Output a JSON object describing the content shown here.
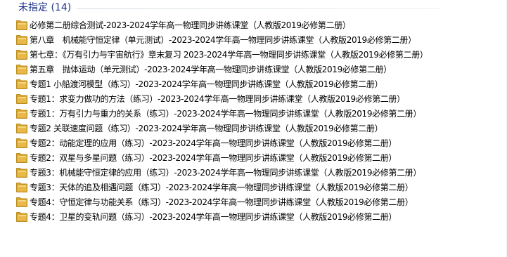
{
  "group": {
    "label": "未指定",
    "count_text": "(14)"
  },
  "icons": {
    "item_icon": "folder-icon",
    "folder_color": "#e8b84a"
  },
  "items": [
    {
      "name": "必修第二册综合测试-2023-2024学年高一物理同步讲练课堂（人教版2019必修第二册）"
    },
    {
      "name": "第八章　机械能守恒定律（单元测试）-2023-2024学年高一物理同步讲练课堂（人教版2019必修第二册）"
    },
    {
      "name": "第七章：《万有引力与宇宙航行》章末复习 2023-2024学年高一物理同步讲练课堂（人教版2019必修第二册）"
    },
    {
      "name": "第五章　抛体运动（单元测试）-2023-2024学年高一物理同步讲练课堂（人教版2019必修第二册）"
    },
    {
      "name": "专题1  小船渡河模型（练习）-2023-2024学年高一物理同步讲练课堂（人教版2019必修第二册）"
    },
    {
      "name": "专题1：求变力做功的方法（练习）-2023-2024学年高一物理同步讲练课堂（人教版2019必修第二册）"
    },
    {
      "name": "专题1：万有引力与重力的关系（练习）-2023-2024学年高一物理同步讲练课堂（人教版2019必修第二册）"
    },
    {
      "name": "专题2  关联速度问题（练习）-2023-2024学年高一物理同步讲练课堂（人教版2019必修第二册）"
    },
    {
      "name": "专题2：动能定理的应用（练习）-2023-2024学年高一物理同步讲练课堂（人教版2019必修第二册）"
    },
    {
      "name": "专题2：双星与多星问题（练习）-2023-2024学年高一物理同步讲练课堂（人教版2019必修第二册）"
    },
    {
      "name": "专题3：机械能守恒定律的应用（练习）-2023-2024学年高一物理同步讲练课堂（人教版2019必修第二册）"
    },
    {
      "name": "专题3：天体的追及相遇问题（练习）-2023-2024学年高一物理同步讲练课堂（人教版2019必修第二册）"
    },
    {
      "name": "专题4：守恒定律与功能关系（练习）-2023-2024学年高一物理同步讲练课堂（人教版2019必修第二册）"
    },
    {
      "name": "专题4：卫星的变轨问题（练习）-2023-2024学年高一物理同步讲练课堂（人教版2019必修第二册）"
    }
  ]
}
